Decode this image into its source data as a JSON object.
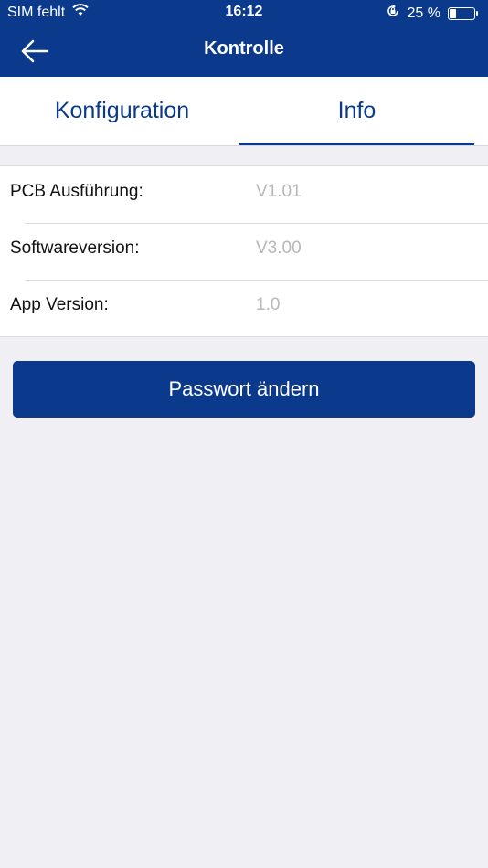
{
  "status_bar": {
    "carrier": "SIM fehlt",
    "time": "16:12",
    "battery_percent": "25 %",
    "battery_level": 0.25
  },
  "nav": {
    "title": "Kontrolle",
    "back_icon": "arrow-left-icon"
  },
  "tabs": [
    {
      "label": "Konfiguration",
      "selected": false
    },
    {
      "label": "Info",
      "selected": true
    }
  ],
  "info": {
    "rows": [
      {
        "label": "PCB Ausführung:",
        "value": "V1.01"
      },
      {
        "label": "Softwareversion:",
        "value": "V3.00"
      },
      {
        "label": "App Version:",
        "value": "1.0"
      }
    ]
  },
  "actions": {
    "change_password_label": "Passwort ändern"
  },
  "colors": {
    "primary": "#0b3a8c",
    "background": "#efeff4",
    "muted_value": "#b8b8bc"
  }
}
